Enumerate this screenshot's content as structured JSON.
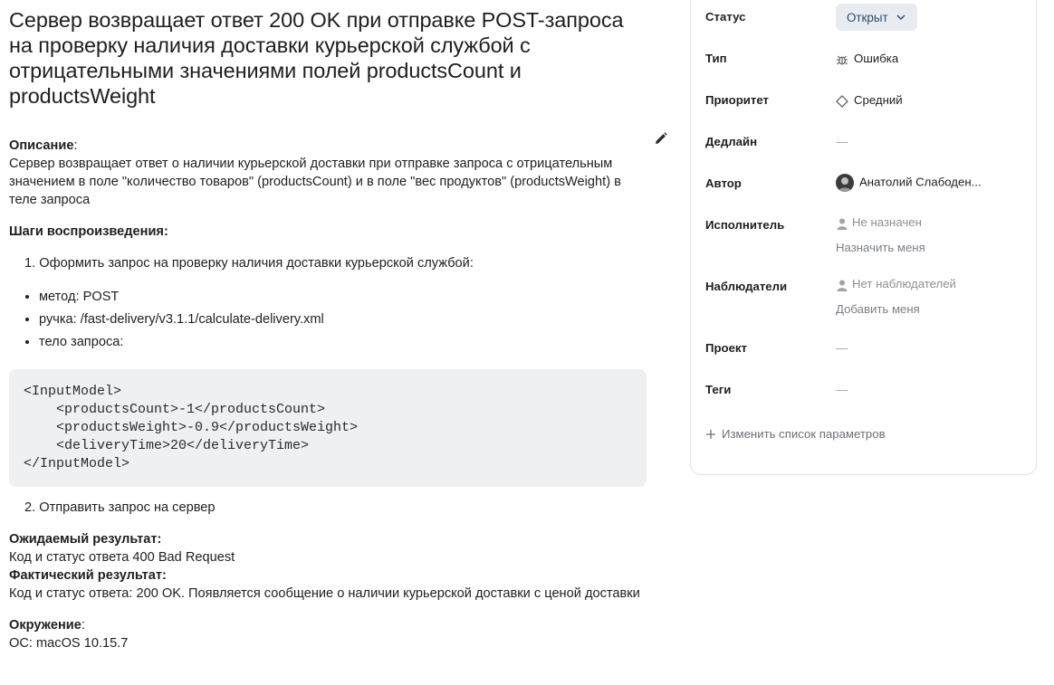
{
  "issue": {
    "title": "Сервер возвращает ответ 200 OK при отправке POST-запроса на проверку наличия доставки курьерской службой с отрицательными значениями полей productsCount и productsWeight",
    "description_label": "Описание",
    "description_colon": ":",
    "description_text": "Сервер возвращает ответ о наличии курьерской доставки при отправке запроса с отрицательным значением в поле \"количество товаров\" (productsCount) и в поле \"вес продуктов\" (productsWeight) в теле запроса",
    "steps_label": "Шаги воспроизведения:",
    "step1": "1. Оформить запрос на проверку наличия доставки курьерской службой:",
    "bullets": [
      "метод: POST",
      "ручка: /fast-delivery/v3.1.1/calculate-delivery.xml",
      "тело запроса:"
    ],
    "code_lines": [
      "<InputModel>",
      "    <productsCount>-1</productsCount>",
      "    <productsWeight>-0.9</productsWeight>",
      "    <deliveryTime>20</deliveryTime>",
      "</InputModel>"
    ],
    "step2": "2. Отправить запрос на сервер",
    "expected_label": "Ожидаемый результат:",
    "expected_text": "Код и статус ответа 400 Bad Request",
    "actual_label": "Фактический результат:",
    "actual_text": "Код и статус ответа: 200 OK. Появляется сообщение о наличии курьерской доставки с ценой доставки",
    "env_label": "Окружение",
    "env_colon": ":",
    "env_text": "ОС: macOS 10.15.7"
  },
  "panel": {
    "status_label": "Статус",
    "status_value": "Открыт",
    "type_label": "Тип",
    "type_value": "Ошибка",
    "priority_label": "Приоритет",
    "priority_value": "Средний",
    "deadline_label": "Дедлайн",
    "deadline_value": "—",
    "author_label": "Автор",
    "author_value": "Анатолий Слабоден...",
    "assignee_label": "Исполнитель",
    "assignee_value": "Не назначен",
    "assign_me": "Назначить меня",
    "watchers_label": "Наблюдатели",
    "watchers_value": "Нет наблюдателей",
    "add_me": "Добавить меня",
    "project_label": "Проект",
    "project_value": "—",
    "tags_label": "Теги",
    "tags_value": "—",
    "change_params": "Изменить список параметров"
  },
  "colors": {
    "status_bg": "#e8ecf1",
    "status_text": "#2a4a72",
    "code_bg": "#eef0f2"
  },
  "icons": [
    "pencil-icon",
    "chevron-down-icon",
    "bug-icon",
    "diamond-icon",
    "person-icon",
    "plus-icon"
  ]
}
